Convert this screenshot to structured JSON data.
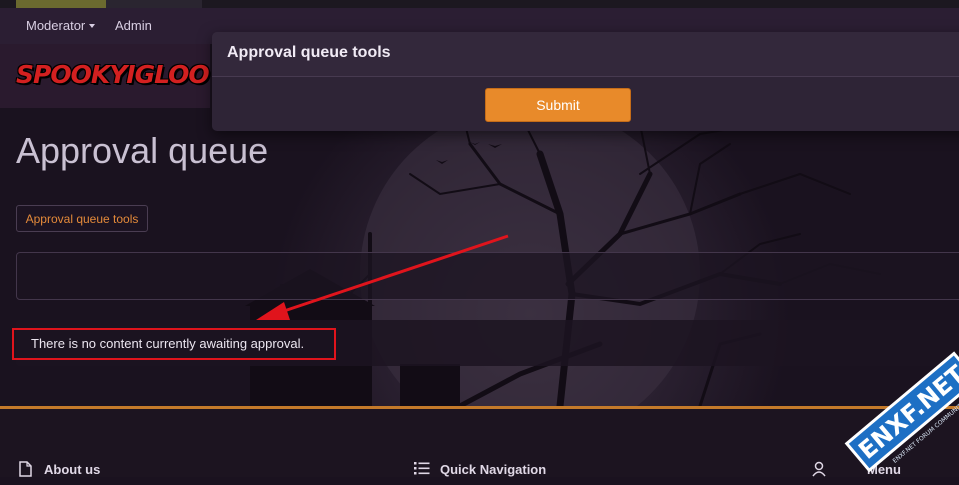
{
  "navbar": {
    "items": [
      {
        "label": "Moderator",
        "has_caret": true
      },
      {
        "label": "Admin"
      }
    ]
  },
  "logo": {
    "text": "SPOOKYIGLOO"
  },
  "page": {
    "title": "Approval queue",
    "tools_button": "Approval queue tools",
    "empty_message": "There is no content currently awaiting approval."
  },
  "modal": {
    "title": "Approval queue tools",
    "submit_label": "Submit"
  },
  "footer": {
    "items": [
      {
        "label": "About us",
        "icon": "file-icon"
      },
      {
        "label": "Quick Navigation",
        "icon": "list-icon"
      },
      {
        "label": "Menu",
        "icon": "user-icon"
      }
    ]
  },
  "watermark": {
    "text": "ENXF.NET",
    "subtext": "ENXF.NET FORUM COMMUNITY"
  },
  "colors": {
    "accent": "#e88a2a",
    "highlight": "#e0141c",
    "background": "#1a121f"
  }
}
